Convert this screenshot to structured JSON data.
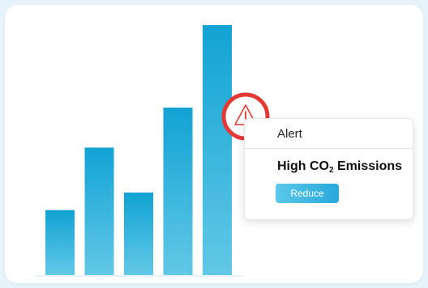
{
  "chart_data": {
    "type": "bar",
    "categories": [
      "",
      "",
      "",
      "",
      ""
    ],
    "values": [
      26,
      51,
      33,
      67,
      100
    ],
    "ylim": [
      0,
      100
    ],
    "grid": false,
    "colors": {
      "top": "#11a3d4",
      "bottom": "#62c8e6"
    }
  },
  "alert_badge": {
    "icon": "warning-triangle-icon",
    "ring_color": "#e53935"
  },
  "alert_card": {
    "header": "Alert",
    "title_prefix": "High CO",
    "title_subscript": "2",
    "title_suffix": " Emissions",
    "button_label": "Reduce"
  },
  "colors": {
    "background": "#e7f3fb",
    "accent": "#28a8dc",
    "alert": "#e53935"
  }
}
